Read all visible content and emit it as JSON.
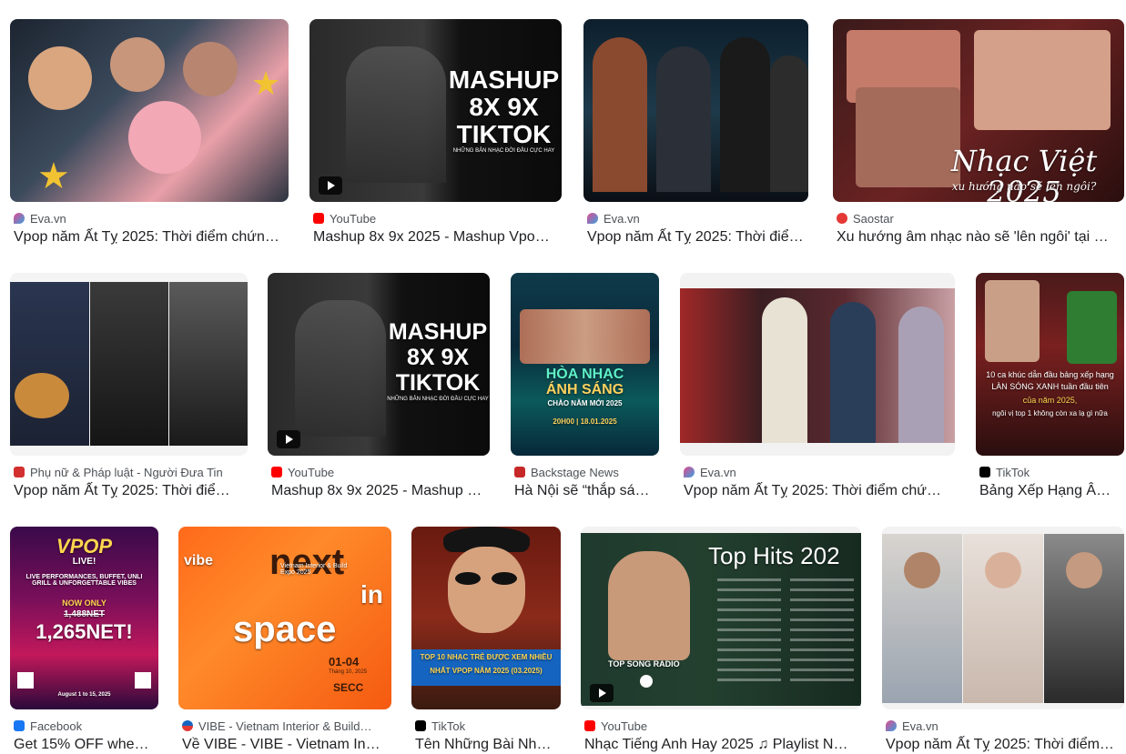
{
  "results": [
    {
      "source": "Eva.vn",
      "source_icon": "eva-icon",
      "title": "Vpop năm Ất Tỵ 2025: Thời điểm chứng…",
      "thumb_text": []
    },
    {
      "source": "YouTube",
      "source_icon": "youtube-icon",
      "title": "Mashup 8x 9x 2025 - Mashup Vpop…",
      "thumb_text": [
        "MASHUP",
        "8X 9X",
        "TIKTOK",
        "NHỮNG BẢN NHẠC ĐỜI ĐẦU CỰC HAY"
      ]
    },
    {
      "source": "Eva.vn",
      "source_icon": "eva-icon",
      "title": "Vpop năm Ất Tỵ 2025: Thời điể…",
      "thumb_text": []
    },
    {
      "source": "Saostar",
      "source_icon": "saostar-icon",
      "title": "Xu hướng âm nhạc nào sẽ 'lên ngôi' tại …",
      "thumb_text": [
        "Nhạc Việt 2025",
        "xu hướng nào sẽ lên ngôi?"
      ]
    },
    {
      "source": "Phụ nữ & Pháp luật - Người Đưa Tin",
      "source_icon": "pnpl-icon",
      "title": "Vpop năm Ất Tỵ 2025: Thời điể…",
      "thumb_text": []
    },
    {
      "source": "YouTube",
      "source_icon": "youtube-icon",
      "title": "Mashup 8x 9x 2025 - Mashup …",
      "thumb_text": [
        "MASHUP",
        "8X 9X",
        "TIKTOK",
        "NHỮNG BẢN NHẠC ĐỜI ĐẦU CỰC HAY"
      ]
    },
    {
      "source": "Backstage News",
      "source_icon": "backstage-icon",
      "title": "Hà Nội sẽ “thắp sá…",
      "thumb_text": [
        "HÒA NHẠC",
        "ÁNH SÁNG",
        "CHÀO NĂM MỚI 2025",
        "20H00 | 18.01.2025"
      ]
    },
    {
      "source": "Eva.vn",
      "source_icon": "eva-icon",
      "title": "Vpop năm Ất Tỵ 2025: Thời điểm chứ…",
      "thumb_text": []
    },
    {
      "source": "TikTok",
      "source_icon": "tiktok-icon",
      "title": "Bảng Xếp Hạng Â…",
      "thumb_text": [
        "10 ca khúc dẫn đầu bảng xếp hạng",
        "LÀN SÓNG XANH tuần đầu tiên",
        "của năm 2025,",
        "ngôi vị top 1 không còn xa lạ gì nữa"
      ]
    },
    {
      "source": "Facebook",
      "source_icon": "facebook-icon",
      "title": "Get 15% OFF whe…",
      "thumb_text": [
        "VPOP",
        "LIVE!",
        "LIVE PERFORMANCES, BUFFET, UNLI GRILL & UNFORGETTABLE VIBES",
        "NOW ONLY",
        "1,488NET",
        "1,265NET!",
        "August 1 to 15, 2025"
      ]
    },
    {
      "source": "VIBE - Vietnam Interior & Build…",
      "source_icon": "vibe-icon",
      "title": "Về VIBE - VIBE - Vietnam In…",
      "thumb_text": [
        "vibe",
        "next",
        "in",
        "space",
        "Vietnam Interior & Build Expo 2025",
        "01-04",
        "Tháng 10, 2025",
        "SECC"
      ]
    },
    {
      "source": "TikTok",
      "source_icon": "tiktok-icon",
      "title": "Tên Những Bài Nh…",
      "thumb_text": [
        "TOP 10 NHẠC TRẺ ĐƯỢC XEM NHIỀU",
        "NHẤT VPOP NĂM 2025 (03.2025)"
      ]
    },
    {
      "source": "YouTube",
      "source_icon": "youtube-icon",
      "title": "Nhạc Tiếng Anh Hay 2025 ♫ Playlist N…",
      "thumb_text": [
        "Top Hits 202",
        "TOP SONG RADIO"
      ]
    },
    {
      "source": "Eva.vn",
      "source_icon": "eva-icon",
      "title": "Vpop năm Ất Tỵ 2025: Thời điểm…",
      "thumb_text": []
    }
  ]
}
